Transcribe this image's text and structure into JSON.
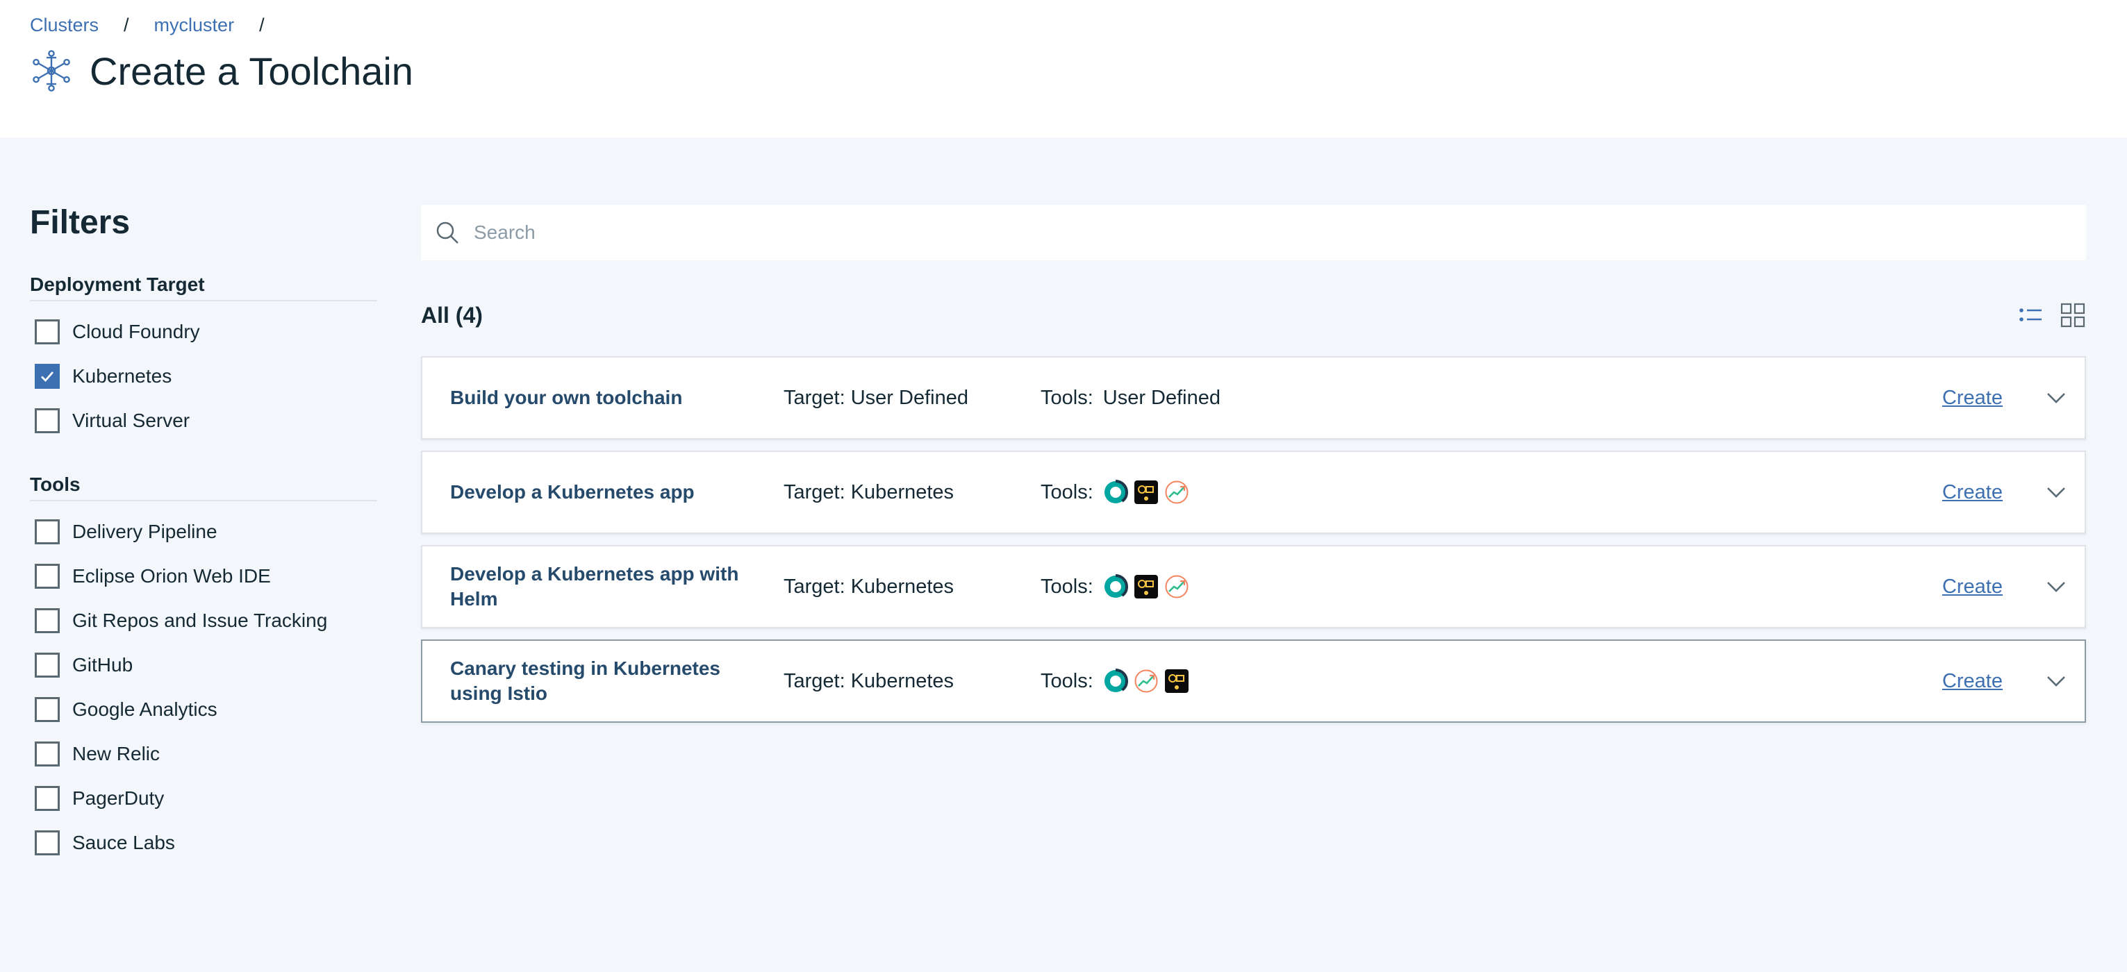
{
  "breadcrumb": {
    "items": [
      "Clusters",
      "mycluster"
    ],
    "separator": "/"
  },
  "page_title": "Create a Toolchain",
  "title_icon": "network-snowflake-icon",
  "filters": {
    "title": "Filters",
    "deployment_target": {
      "title": "Deployment Target",
      "options": [
        {
          "label": "Cloud Foundry",
          "checked": false
        },
        {
          "label": "Kubernetes",
          "checked": true
        },
        {
          "label": "Virtual Server",
          "checked": false
        }
      ]
    },
    "tools": {
      "title": "Tools",
      "options": [
        {
          "label": "Delivery Pipeline",
          "checked": false
        },
        {
          "label": "Eclipse Orion Web IDE",
          "checked": false
        },
        {
          "label": "Git Repos and Issue Tracking",
          "checked": false
        },
        {
          "label": "GitHub",
          "checked": false
        },
        {
          "label": "Google Analytics",
          "checked": false
        },
        {
          "label": "New Relic",
          "checked": false
        },
        {
          "label": "PagerDuty",
          "checked": false
        },
        {
          "label": "Sauce Labs",
          "checked": false
        }
      ]
    }
  },
  "search": {
    "placeholder": "Search",
    "value": ""
  },
  "list": {
    "count_label": "All (4)",
    "create_label": "Create",
    "tools_label": "Tools:",
    "rows": [
      {
        "name": "Build your own toolchain",
        "target": "Target: User Defined",
        "tools_text": "User Defined",
        "tool_icons": []
      },
      {
        "name": "Develop a Kubernetes app",
        "target": "Target: Kubernetes",
        "tools_text": "",
        "tool_icons": [
          "ring-icon",
          "orion-icon",
          "trend-icon"
        ]
      },
      {
        "name": "Develop a Kubernetes app with Helm",
        "target": "Target: Kubernetes",
        "tools_text": "",
        "tool_icons": [
          "ring-icon",
          "orion-icon",
          "trend-icon"
        ]
      },
      {
        "name": "Canary testing in Kubernetes using Istio",
        "target": "Target: Kubernetes",
        "tools_text": "",
        "tool_icons": [
          "ring-icon",
          "trend-icon",
          "orion-icon"
        ]
      }
    ]
  },
  "colors": {
    "accent": "#3d70b2",
    "background": "#f3f6fa",
    "text": "#152935"
  }
}
